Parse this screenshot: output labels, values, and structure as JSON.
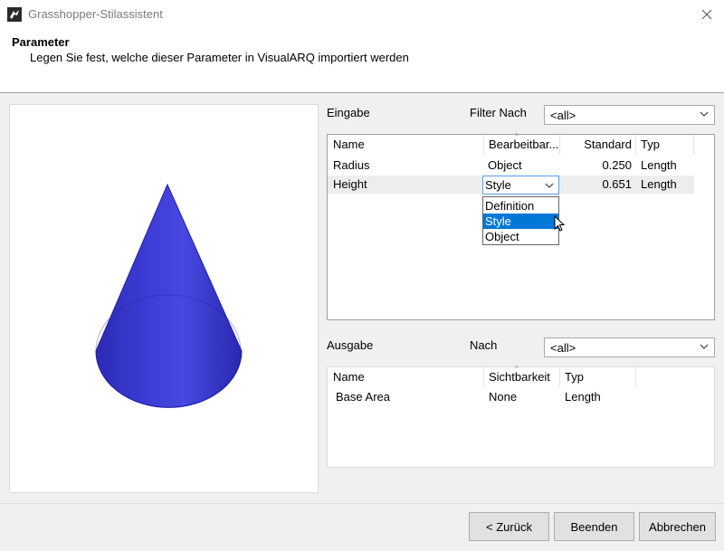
{
  "window": {
    "title": "Grasshopper-Stilassistent",
    "close_icon": "close-icon"
  },
  "header": {
    "title": "Parameter",
    "subtitle": "Legen Sie fest, welche dieser Parameter in VisualARQ importiert werden"
  },
  "preview": {
    "shape": "cone",
    "color": "#3232c8"
  },
  "input": {
    "label": "Eingabe",
    "filter_label": "Filter Nach",
    "filter_value": "<all>",
    "columns": [
      "Name",
      "Bearbeitbar...",
      "Standard",
      "Typ"
    ],
    "rows": [
      {
        "name": "Radius",
        "editable": "Object",
        "default": "0.250",
        "type": "Length"
      },
      {
        "name": "Height",
        "editable": "Style",
        "default": "0.651",
        "type": "Length"
      }
    ],
    "dropdown_options": [
      "Definition",
      "Style",
      "Object"
    ],
    "dropdown_selected": "Style"
  },
  "output": {
    "label": "Ausgabe",
    "filter_label": "Nach",
    "filter_value": "<all>",
    "columns": [
      "Name",
      "Sichtbarkeit",
      "Typ"
    ],
    "rows": [
      {
        "name": "Base Area",
        "visibility": "None",
        "type": "Length"
      }
    ]
  },
  "footer": {
    "back": "< Zurück",
    "finish": "Beenden",
    "cancel": "Abbrechen"
  },
  "colors": {
    "accent": "#0078d7",
    "selection": "#0078d7",
    "row_highlight": "#e5f3ff"
  }
}
